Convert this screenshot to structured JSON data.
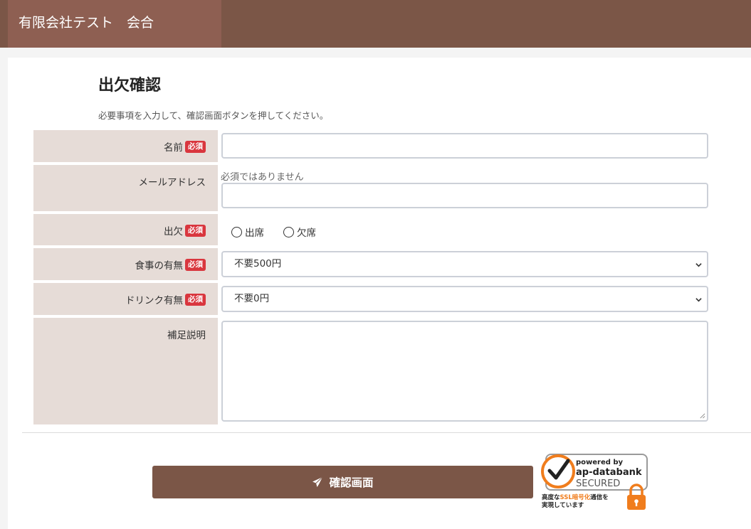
{
  "header": {
    "title": "有限会社テスト　会合"
  },
  "form": {
    "heading": "出欠確認",
    "lead": "必要事項を入力して、確認画面ボタンを押してください。",
    "required_badge": "必須",
    "fields": {
      "name": {
        "label": "名前",
        "value": ""
      },
      "email": {
        "label": "メールアドレス",
        "note": "必須ではありません",
        "value": ""
      },
      "attendance": {
        "label": "出欠",
        "options": [
          "出席",
          "欠席"
        ]
      },
      "meal": {
        "label": "食事の有無",
        "selected": "不要500円"
      },
      "drink": {
        "label": "ドリンク有無",
        "selected": "不要0円"
      },
      "remarks": {
        "label": "補足説明",
        "value": ""
      }
    },
    "submit_label": "確認画面"
  },
  "seal": {
    "line1": "powered by",
    "line2": "ap-databank",
    "line3": "SECURED",
    "caption1_pre": "高度な",
    "caption1_em": "SSL暗号化",
    "caption1_post": "通信を",
    "caption2": "実現しています"
  },
  "colors": {
    "brand": "#7b5647",
    "brand_light": "#8e5f52",
    "label_bg": "#e6dcd7",
    "required": "#d9363e",
    "seal_orange": "#f07d1d"
  }
}
